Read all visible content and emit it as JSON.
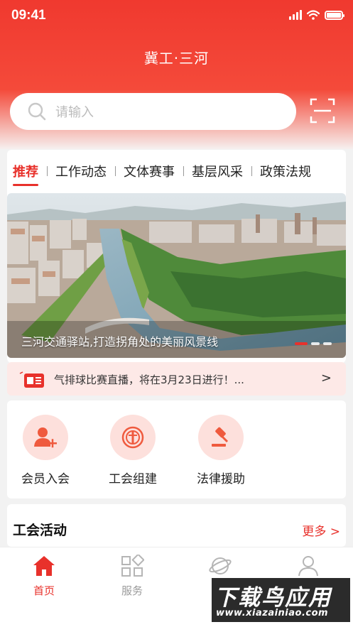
{
  "status_bar": {
    "time": "09:41"
  },
  "header": {
    "title": "冀工·三河",
    "search_placeholder": "请输入"
  },
  "tabs": [
    {
      "label": "推荐",
      "active": true
    },
    {
      "label": "工作动态",
      "active": false
    },
    {
      "label": "文体赛事",
      "active": false
    },
    {
      "label": "基层风采",
      "active": false
    },
    {
      "label": "政策法规",
      "active": false
    }
  ],
  "banner": {
    "caption": "三河交通驿站,打造拐角处的美丽风景线",
    "slides": 3,
    "active_slide": 1
  },
  "notice": {
    "text": "气排球比赛直播，将在3月23日进行！...",
    "arrow": ">"
  },
  "quick_actions": [
    {
      "label": "会员入会",
      "icon": "member-join-icon"
    },
    {
      "label": "工会组建",
      "icon": "union-emblem-icon"
    },
    {
      "label": "法律援助",
      "icon": "gavel-icon"
    }
  ],
  "activity": {
    "title": "工会活动",
    "more": "更多 >"
  },
  "tabbar": [
    {
      "label": "首页",
      "icon": "home-icon",
      "active": true
    },
    {
      "label": "服务",
      "icon": "grid-icon",
      "active": false
    },
    {
      "label": "",
      "icon": "planet-icon",
      "active": false
    },
    {
      "label": "",
      "icon": "user-icon",
      "active": false
    }
  ],
  "watermark": {
    "main": "下载鸟应用",
    "url": "www.xiazainiao.com"
  },
  "colors": {
    "accent": "#e8312b",
    "header": "#f0392f",
    "notice_bg": "#fde9e7"
  }
}
